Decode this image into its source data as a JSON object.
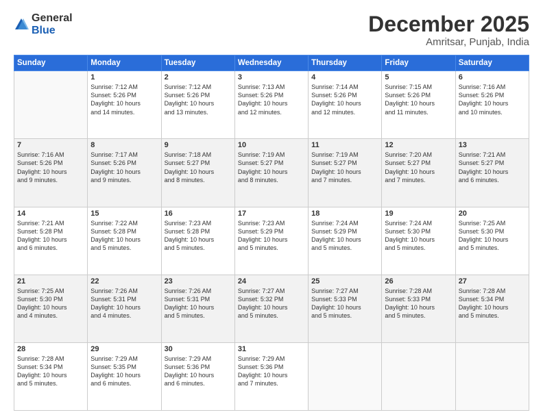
{
  "logo": {
    "general": "General",
    "blue": "Blue"
  },
  "header": {
    "month": "December 2025",
    "location": "Amritsar, Punjab, India"
  },
  "weekdays": [
    "Sunday",
    "Monday",
    "Tuesday",
    "Wednesday",
    "Thursday",
    "Friday",
    "Saturday"
  ],
  "weeks": [
    [
      {
        "day": "",
        "info": ""
      },
      {
        "day": "1",
        "info": "Sunrise: 7:12 AM\nSunset: 5:26 PM\nDaylight: 10 hours\nand 14 minutes."
      },
      {
        "day": "2",
        "info": "Sunrise: 7:12 AM\nSunset: 5:26 PM\nDaylight: 10 hours\nand 13 minutes."
      },
      {
        "day": "3",
        "info": "Sunrise: 7:13 AM\nSunset: 5:26 PM\nDaylight: 10 hours\nand 12 minutes."
      },
      {
        "day": "4",
        "info": "Sunrise: 7:14 AM\nSunset: 5:26 PM\nDaylight: 10 hours\nand 12 minutes."
      },
      {
        "day": "5",
        "info": "Sunrise: 7:15 AM\nSunset: 5:26 PM\nDaylight: 10 hours\nand 11 minutes."
      },
      {
        "day": "6",
        "info": "Sunrise: 7:16 AM\nSunset: 5:26 PM\nDaylight: 10 hours\nand 10 minutes."
      }
    ],
    [
      {
        "day": "7",
        "info": "Sunrise: 7:16 AM\nSunset: 5:26 PM\nDaylight: 10 hours\nand 9 minutes."
      },
      {
        "day": "8",
        "info": "Sunrise: 7:17 AM\nSunset: 5:26 PM\nDaylight: 10 hours\nand 9 minutes."
      },
      {
        "day": "9",
        "info": "Sunrise: 7:18 AM\nSunset: 5:27 PM\nDaylight: 10 hours\nand 8 minutes."
      },
      {
        "day": "10",
        "info": "Sunrise: 7:19 AM\nSunset: 5:27 PM\nDaylight: 10 hours\nand 8 minutes."
      },
      {
        "day": "11",
        "info": "Sunrise: 7:19 AM\nSunset: 5:27 PM\nDaylight: 10 hours\nand 7 minutes."
      },
      {
        "day": "12",
        "info": "Sunrise: 7:20 AM\nSunset: 5:27 PM\nDaylight: 10 hours\nand 7 minutes."
      },
      {
        "day": "13",
        "info": "Sunrise: 7:21 AM\nSunset: 5:27 PM\nDaylight: 10 hours\nand 6 minutes."
      }
    ],
    [
      {
        "day": "14",
        "info": "Sunrise: 7:21 AM\nSunset: 5:28 PM\nDaylight: 10 hours\nand 6 minutes."
      },
      {
        "day": "15",
        "info": "Sunrise: 7:22 AM\nSunset: 5:28 PM\nDaylight: 10 hours\nand 5 minutes."
      },
      {
        "day": "16",
        "info": "Sunrise: 7:23 AM\nSunset: 5:28 PM\nDaylight: 10 hours\nand 5 minutes."
      },
      {
        "day": "17",
        "info": "Sunrise: 7:23 AM\nSunset: 5:29 PM\nDaylight: 10 hours\nand 5 minutes."
      },
      {
        "day": "18",
        "info": "Sunrise: 7:24 AM\nSunset: 5:29 PM\nDaylight: 10 hours\nand 5 minutes."
      },
      {
        "day": "19",
        "info": "Sunrise: 7:24 AM\nSunset: 5:30 PM\nDaylight: 10 hours\nand 5 minutes."
      },
      {
        "day": "20",
        "info": "Sunrise: 7:25 AM\nSunset: 5:30 PM\nDaylight: 10 hours\nand 5 minutes."
      }
    ],
    [
      {
        "day": "21",
        "info": "Sunrise: 7:25 AM\nSunset: 5:30 PM\nDaylight: 10 hours\nand 4 minutes."
      },
      {
        "day": "22",
        "info": "Sunrise: 7:26 AM\nSunset: 5:31 PM\nDaylight: 10 hours\nand 4 minutes."
      },
      {
        "day": "23",
        "info": "Sunrise: 7:26 AM\nSunset: 5:31 PM\nDaylight: 10 hours\nand 5 minutes."
      },
      {
        "day": "24",
        "info": "Sunrise: 7:27 AM\nSunset: 5:32 PM\nDaylight: 10 hours\nand 5 minutes."
      },
      {
        "day": "25",
        "info": "Sunrise: 7:27 AM\nSunset: 5:33 PM\nDaylight: 10 hours\nand 5 minutes."
      },
      {
        "day": "26",
        "info": "Sunrise: 7:28 AM\nSunset: 5:33 PM\nDaylight: 10 hours\nand 5 minutes."
      },
      {
        "day": "27",
        "info": "Sunrise: 7:28 AM\nSunset: 5:34 PM\nDaylight: 10 hours\nand 5 minutes."
      }
    ],
    [
      {
        "day": "28",
        "info": "Sunrise: 7:28 AM\nSunset: 5:34 PM\nDaylight: 10 hours\nand 5 minutes."
      },
      {
        "day": "29",
        "info": "Sunrise: 7:29 AM\nSunset: 5:35 PM\nDaylight: 10 hours\nand 6 minutes."
      },
      {
        "day": "30",
        "info": "Sunrise: 7:29 AM\nSunset: 5:36 PM\nDaylight: 10 hours\nand 6 minutes."
      },
      {
        "day": "31",
        "info": "Sunrise: 7:29 AM\nSunset: 5:36 PM\nDaylight: 10 hours\nand 7 minutes."
      },
      {
        "day": "",
        "info": ""
      },
      {
        "day": "",
        "info": ""
      },
      {
        "day": "",
        "info": ""
      }
    ]
  ]
}
